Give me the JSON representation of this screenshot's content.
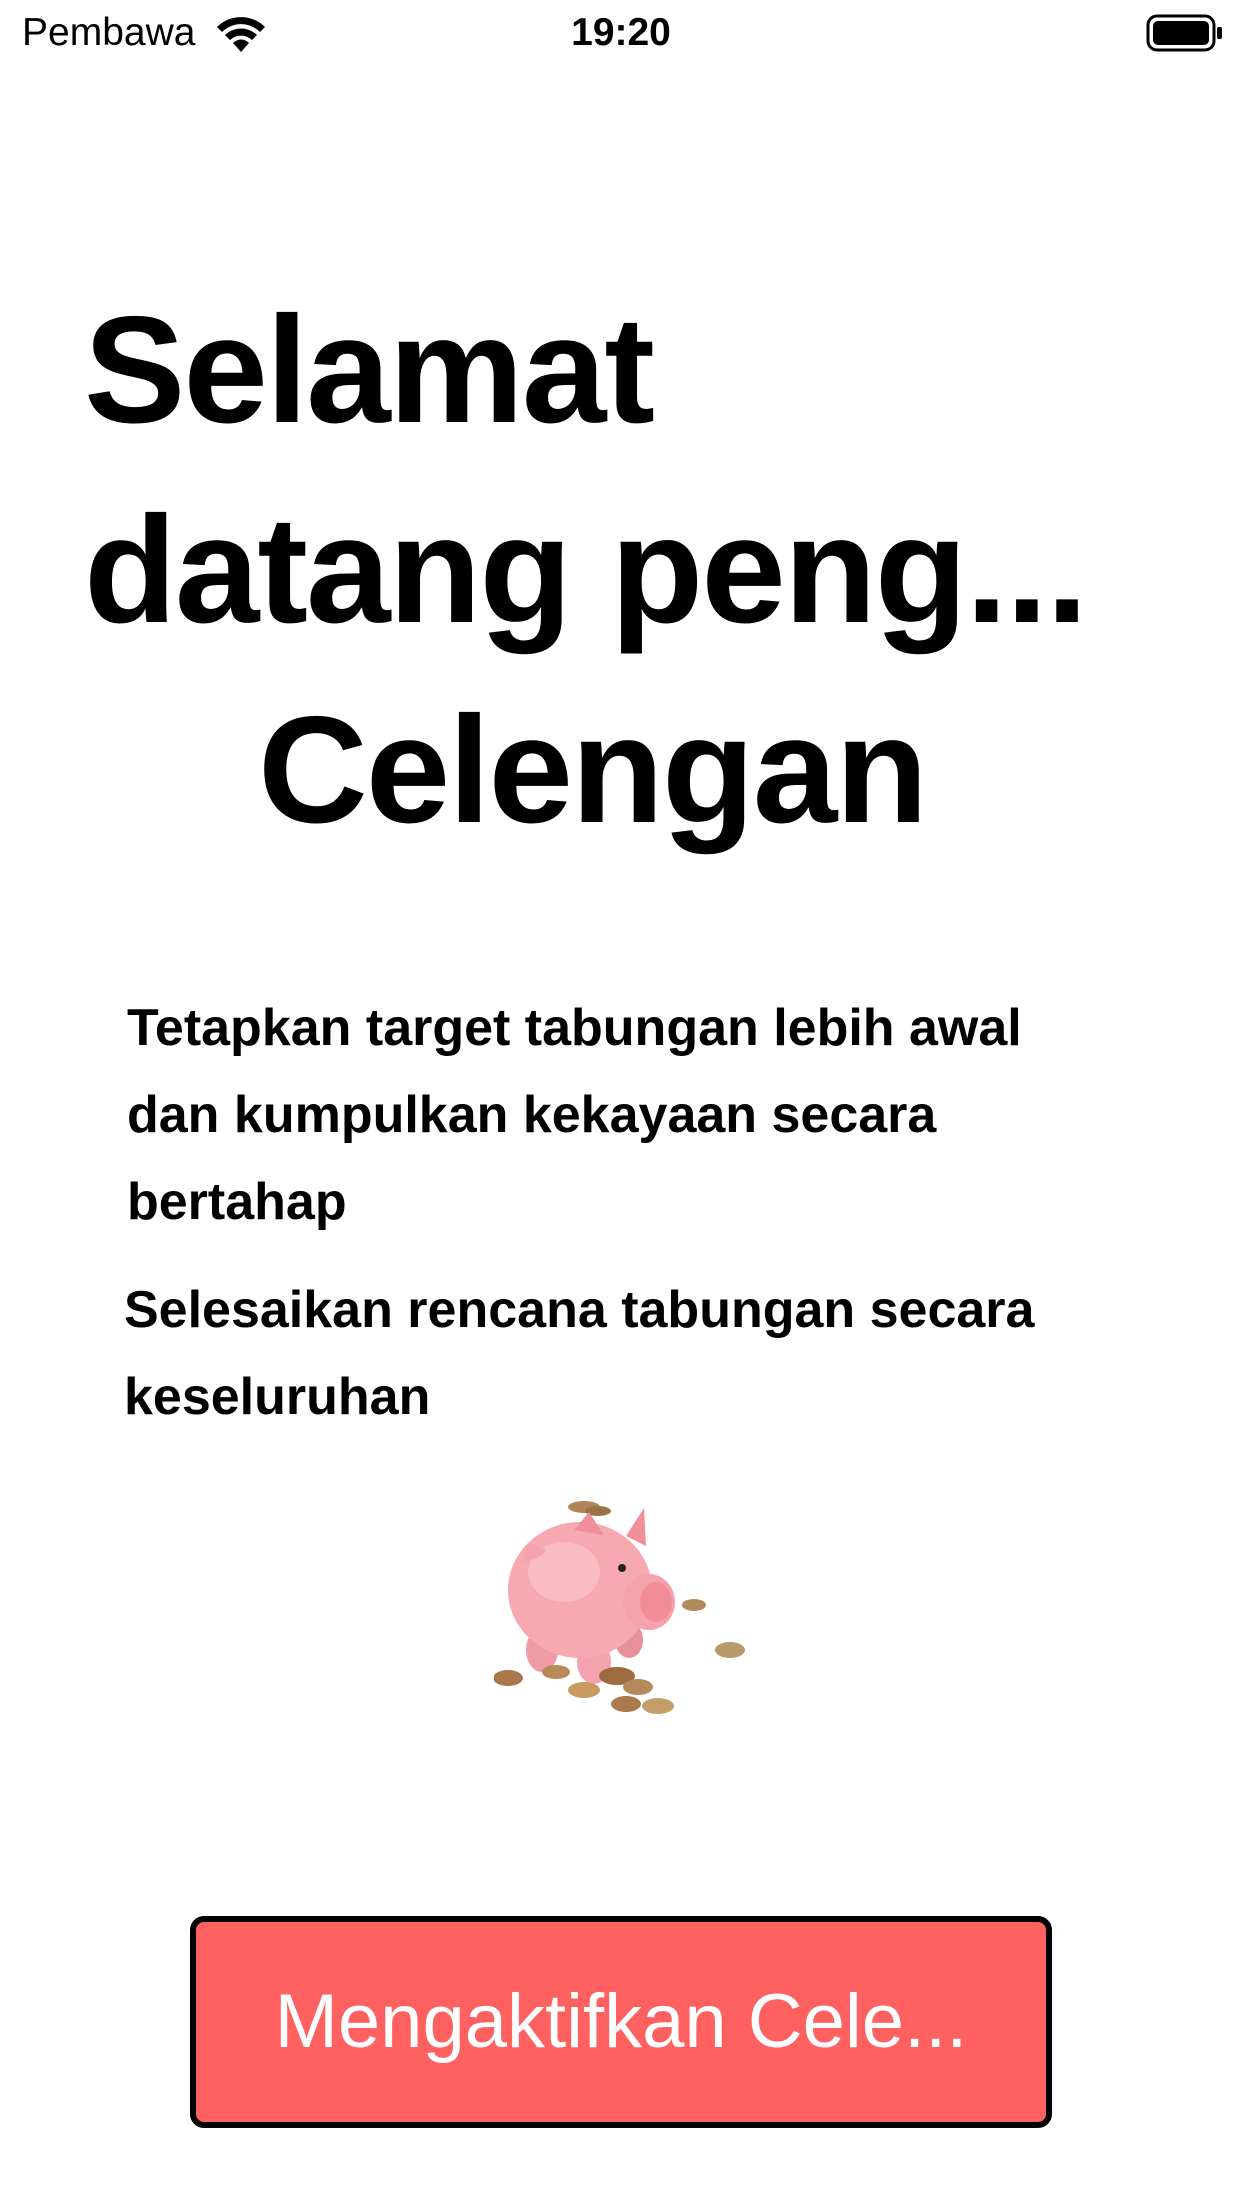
{
  "status_bar": {
    "carrier": "Pembawa",
    "time": "19:20",
    "icons": [
      "wifi-icon",
      "battery-icon"
    ]
  },
  "welcome": {
    "title_line1": "Selamat",
    "title_line2": "datang peng...",
    "title_line3": "Celengan",
    "description_lines": [
      "Tetapkan target tabungan lebih awal",
      "dan kumpulkan kekayaan secara",
      "bertahap"
    ],
    "description2_lines": [
      "Selesaikan rencana tabungan secara",
      "keseluruhan"
    ]
  },
  "illustration": {
    "icon": "piggy-bank-with-coins",
    "colors": {
      "pig": "#f7a9b2",
      "coin": "#b0855a"
    }
  },
  "cta": {
    "label": "Mengaktifkan Cele...",
    "background": "#ff6161",
    "border": "#000000",
    "text_color": "#ffffff"
  }
}
